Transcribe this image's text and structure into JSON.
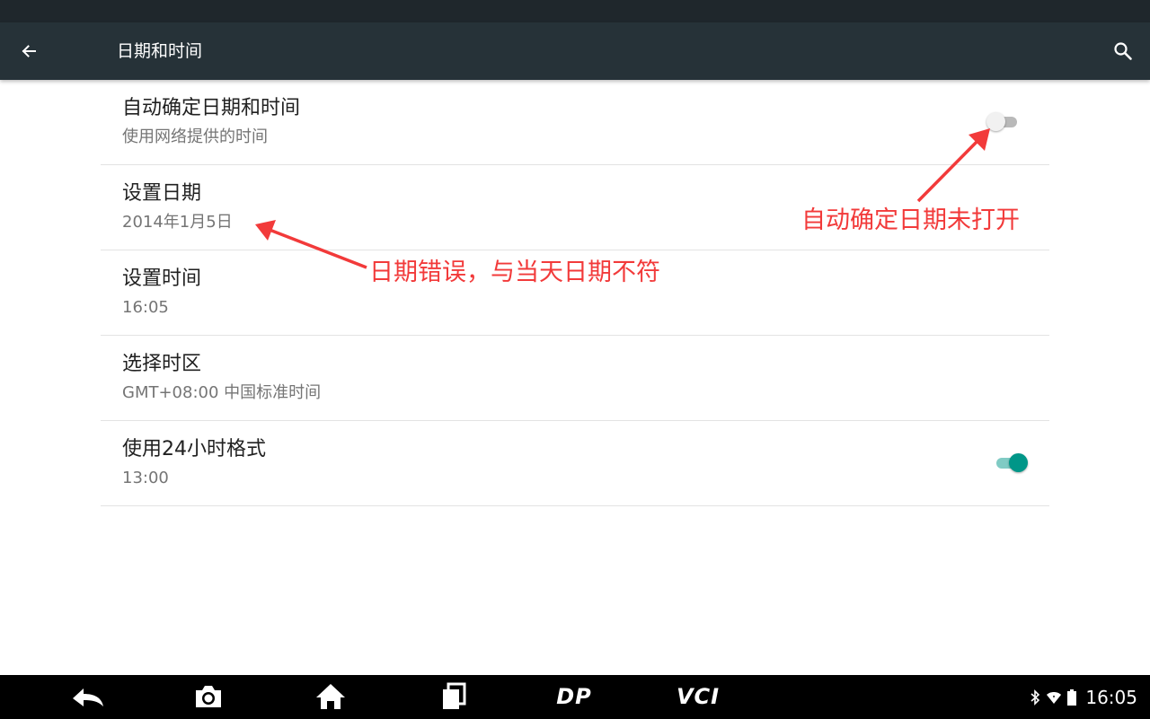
{
  "header": {
    "title": "日期和时间"
  },
  "preferences": [
    {
      "title": "自动确定日期和时间",
      "summary": "使用网络提供的时间",
      "switch": "off"
    },
    {
      "title": "设置日期",
      "summary": "2014年1月5日"
    },
    {
      "title": "设置时间",
      "summary": "16:05"
    },
    {
      "title": "选择时区",
      "summary": "GMT+08:00 中国标准时间"
    },
    {
      "title": "使用24小时格式",
      "summary": "13:00",
      "switch": "on"
    }
  ],
  "annotations": {
    "auto_off": "自动确定日期未打开",
    "wrong_date": "日期错误，与当天日期不符",
    "color": "#f23a3a"
  },
  "navbar": {
    "brand_dp": "DP",
    "brand_vci": "VCI",
    "clock": "16:05"
  },
  "colors": {
    "action_bar": "#263238",
    "accent": "#009688"
  }
}
